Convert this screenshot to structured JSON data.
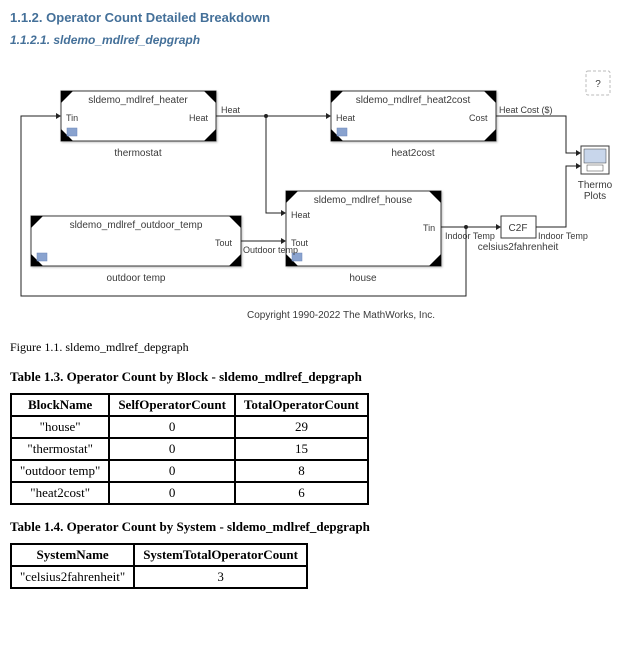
{
  "headings": {
    "section": "1.1.2. Operator Count Detailed Breakdown",
    "subsection": "1.1.2.1. sldemo_mdlref_depgraph"
  },
  "diagram": {
    "help": "?",
    "blocks": {
      "heater": {
        "title": "sldemo_mdlref_heater",
        "label": "thermostat",
        "portIn": "Tin",
        "portOut": "Heat"
      },
      "outdoor": {
        "title": "sldemo_mdlref_outdoor_temp",
        "label": "outdoor temp",
        "portOut": "Tout"
      },
      "house": {
        "title": "sldemo_mdlref_house",
        "label": "house",
        "portIn1": "Heat",
        "portIn2": "Tout",
        "portOut": "Tin"
      },
      "heat2cost": {
        "title": "sldemo_mdlref_heat2cost",
        "label": "heat2cost",
        "portIn": "Heat",
        "portOut": "Cost"
      },
      "c2f": {
        "title": "C2F",
        "label": "celsius2fahrenheit"
      },
      "scope": {
        "label": "Thermo Plots"
      }
    },
    "signals": {
      "heat": "Heat",
      "outdoorTemp": "Outdoor temp",
      "indoorTemp": "Indoor Temp",
      "heatCost": "Heat Cost ($)",
      "indoorTemp2": "Indoor Temp"
    },
    "copyright": "Copyright 1990-2022 The MathWorks, Inc."
  },
  "figure_caption": "Figure 1.1. sldemo_mdlref_depgraph",
  "table1": {
    "title": "Table 1.3. Operator Count by Block - sldemo_mdlref_depgraph",
    "headers": [
      "BlockName",
      "SelfOperatorCount",
      "TotalOperatorCount"
    ],
    "rows": [
      [
        "\"house\"",
        "0",
        "29"
      ],
      [
        "\"thermostat\"",
        "0",
        "15"
      ],
      [
        "\"outdoor temp\"",
        "0",
        "8"
      ],
      [
        "\"heat2cost\"",
        "0",
        "6"
      ]
    ]
  },
  "table2": {
    "title": "Table 1.4. Operator Count by System - sldemo_mdlref_depgraph",
    "headers": [
      "SystemName",
      "SystemTotalOperatorCount"
    ],
    "rows": [
      [
        "\"celsius2fahrenheit\"",
        "3"
      ]
    ]
  }
}
